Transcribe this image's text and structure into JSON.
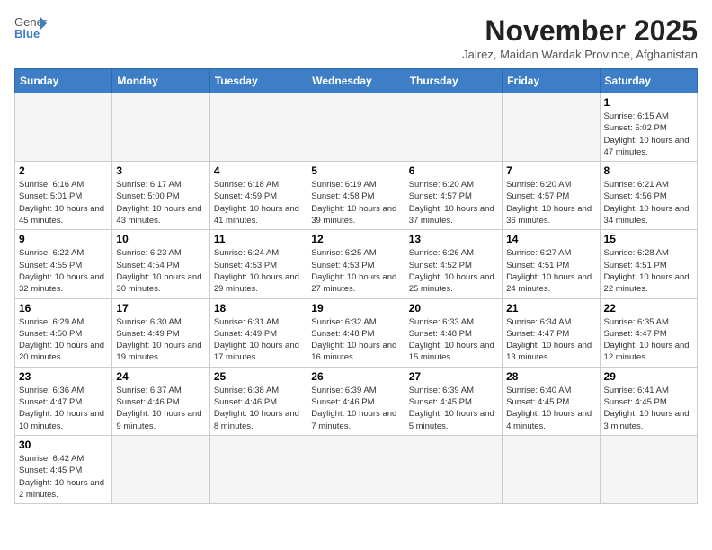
{
  "logo": {
    "text_general": "General",
    "text_blue": "Blue"
  },
  "title": "November 2025",
  "subtitle": "Jalrez, Maidan Wardak Province, Afghanistan",
  "headers": [
    "Sunday",
    "Monday",
    "Tuesday",
    "Wednesday",
    "Thursday",
    "Friday",
    "Saturday"
  ],
  "weeks": [
    [
      {
        "day": "",
        "info": "",
        "empty": true
      },
      {
        "day": "",
        "info": "",
        "empty": true
      },
      {
        "day": "",
        "info": "",
        "empty": true
      },
      {
        "day": "",
        "info": "",
        "empty": true
      },
      {
        "day": "",
        "info": "",
        "empty": true
      },
      {
        "day": "",
        "info": "",
        "empty": true
      },
      {
        "day": "1",
        "info": "Sunrise: 6:15 AM\nSunset: 5:02 PM\nDaylight: 10 hours and 47 minutes."
      }
    ],
    [
      {
        "day": "2",
        "info": "Sunrise: 6:16 AM\nSunset: 5:01 PM\nDaylight: 10 hours and 45 minutes."
      },
      {
        "day": "3",
        "info": "Sunrise: 6:17 AM\nSunset: 5:00 PM\nDaylight: 10 hours and 43 minutes."
      },
      {
        "day": "4",
        "info": "Sunrise: 6:18 AM\nSunset: 4:59 PM\nDaylight: 10 hours and 41 minutes."
      },
      {
        "day": "5",
        "info": "Sunrise: 6:19 AM\nSunset: 4:58 PM\nDaylight: 10 hours and 39 minutes."
      },
      {
        "day": "6",
        "info": "Sunrise: 6:20 AM\nSunset: 4:57 PM\nDaylight: 10 hours and 37 minutes."
      },
      {
        "day": "7",
        "info": "Sunrise: 6:20 AM\nSunset: 4:57 PM\nDaylight: 10 hours and 36 minutes."
      },
      {
        "day": "8",
        "info": "Sunrise: 6:21 AM\nSunset: 4:56 PM\nDaylight: 10 hours and 34 minutes."
      }
    ],
    [
      {
        "day": "9",
        "info": "Sunrise: 6:22 AM\nSunset: 4:55 PM\nDaylight: 10 hours and 32 minutes."
      },
      {
        "day": "10",
        "info": "Sunrise: 6:23 AM\nSunset: 4:54 PM\nDaylight: 10 hours and 30 minutes."
      },
      {
        "day": "11",
        "info": "Sunrise: 6:24 AM\nSunset: 4:53 PM\nDaylight: 10 hours and 29 minutes."
      },
      {
        "day": "12",
        "info": "Sunrise: 6:25 AM\nSunset: 4:53 PM\nDaylight: 10 hours and 27 minutes."
      },
      {
        "day": "13",
        "info": "Sunrise: 6:26 AM\nSunset: 4:52 PM\nDaylight: 10 hours and 25 minutes."
      },
      {
        "day": "14",
        "info": "Sunrise: 6:27 AM\nSunset: 4:51 PM\nDaylight: 10 hours and 24 minutes."
      },
      {
        "day": "15",
        "info": "Sunrise: 6:28 AM\nSunset: 4:51 PM\nDaylight: 10 hours and 22 minutes."
      }
    ],
    [
      {
        "day": "16",
        "info": "Sunrise: 6:29 AM\nSunset: 4:50 PM\nDaylight: 10 hours and 20 minutes."
      },
      {
        "day": "17",
        "info": "Sunrise: 6:30 AM\nSunset: 4:49 PM\nDaylight: 10 hours and 19 minutes."
      },
      {
        "day": "18",
        "info": "Sunrise: 6:31 AM\nSunset: 4:49 PM\nDaylight: 10 hours and 17 minutes."
      },
      {
        "day": "19",
        "info": "Sunrise: 6:32 AM\nSunset: 4:48 PM\nDaylight: 10 hours and 16 minutes."
      },
      {
        "day": "20",
        "info": "Sunrise: 6:33 AM\nSunset: 4:48 PM\nDaylight: 10 hours and 15 minutes."
      },
      {
        "day": "21",
        "info": "Sunrise: 6:34 AM\nSunset: 4:47 PM\nDaylight: 10 hours and 13 minutes."
      },
      {
        "day": "22",
        "info": "Sunrise: 6:35 AM\nSunset: 4:47 PM\nDaylight: 10 hours and 12 minutes."
      }
    ],
    [
      {
        "day": "23",
        "info": "Sunrise: 6:36 AM\nSunset: 4:47 PM\nDaylight: 10 hours and 10 minutes."
      },
      {
        "day": "24",
        "info": "Sunrise: 6:37 AM\nSunset: 4:46 PM\nDaylight: 10 hours and 9 minutes."
      },
      {
        "day": "25",
        "info": "Sunrise: 6:38 AM\nSunset: 4:46 PM\nDaylight: 10 hours and 8 minutes."
      },
      {
        "day": "26",
        "info": "Sunrise: 6:39 AM\nSunset: 4:46 PM\nDaylight: 10 hours and 7 minutes."
      },
      {
        "day": "27",
        "info": "Sunrise: 6:39 AM\nSunset: 4:45 PM\nDaylight: 10 hours and 5 minutes."
      },
      {
        "day": "28",
        "info": "Sunrise: 6:40 AM\nSunset: 4:45 PM\nDaylight: 10 hours and 4 minutes."
      },
      {
        "day": "29",
        "info": "Sunrise: 6:41 AM\nSunset: 4:45 PM\nDaylight: 10 hours and 3 minutes."
      }
    ],
    [
      {
        "day": "30",
        "info": "Sunrise: 6:42 AM\nSunset: 4:45 PM\nDaylight: 10 hours and 2 minutes."
      },
      {
        "day": "",
        "info": "",
        "empty": true
      },
      {
        "day": "",
        "info": "",
        "empty": true
      },
      {
        "day": "",
        "info": "",
        "empty": true
      },
      {
        "day": "",
        "info": "",
        "empty": true
      },
      {
        "day": "",
        "info": "",
        "empty": true
      },
      {
        "day": "",
        "info": "",
        "empty": true
      }
    ]
  ]
}
